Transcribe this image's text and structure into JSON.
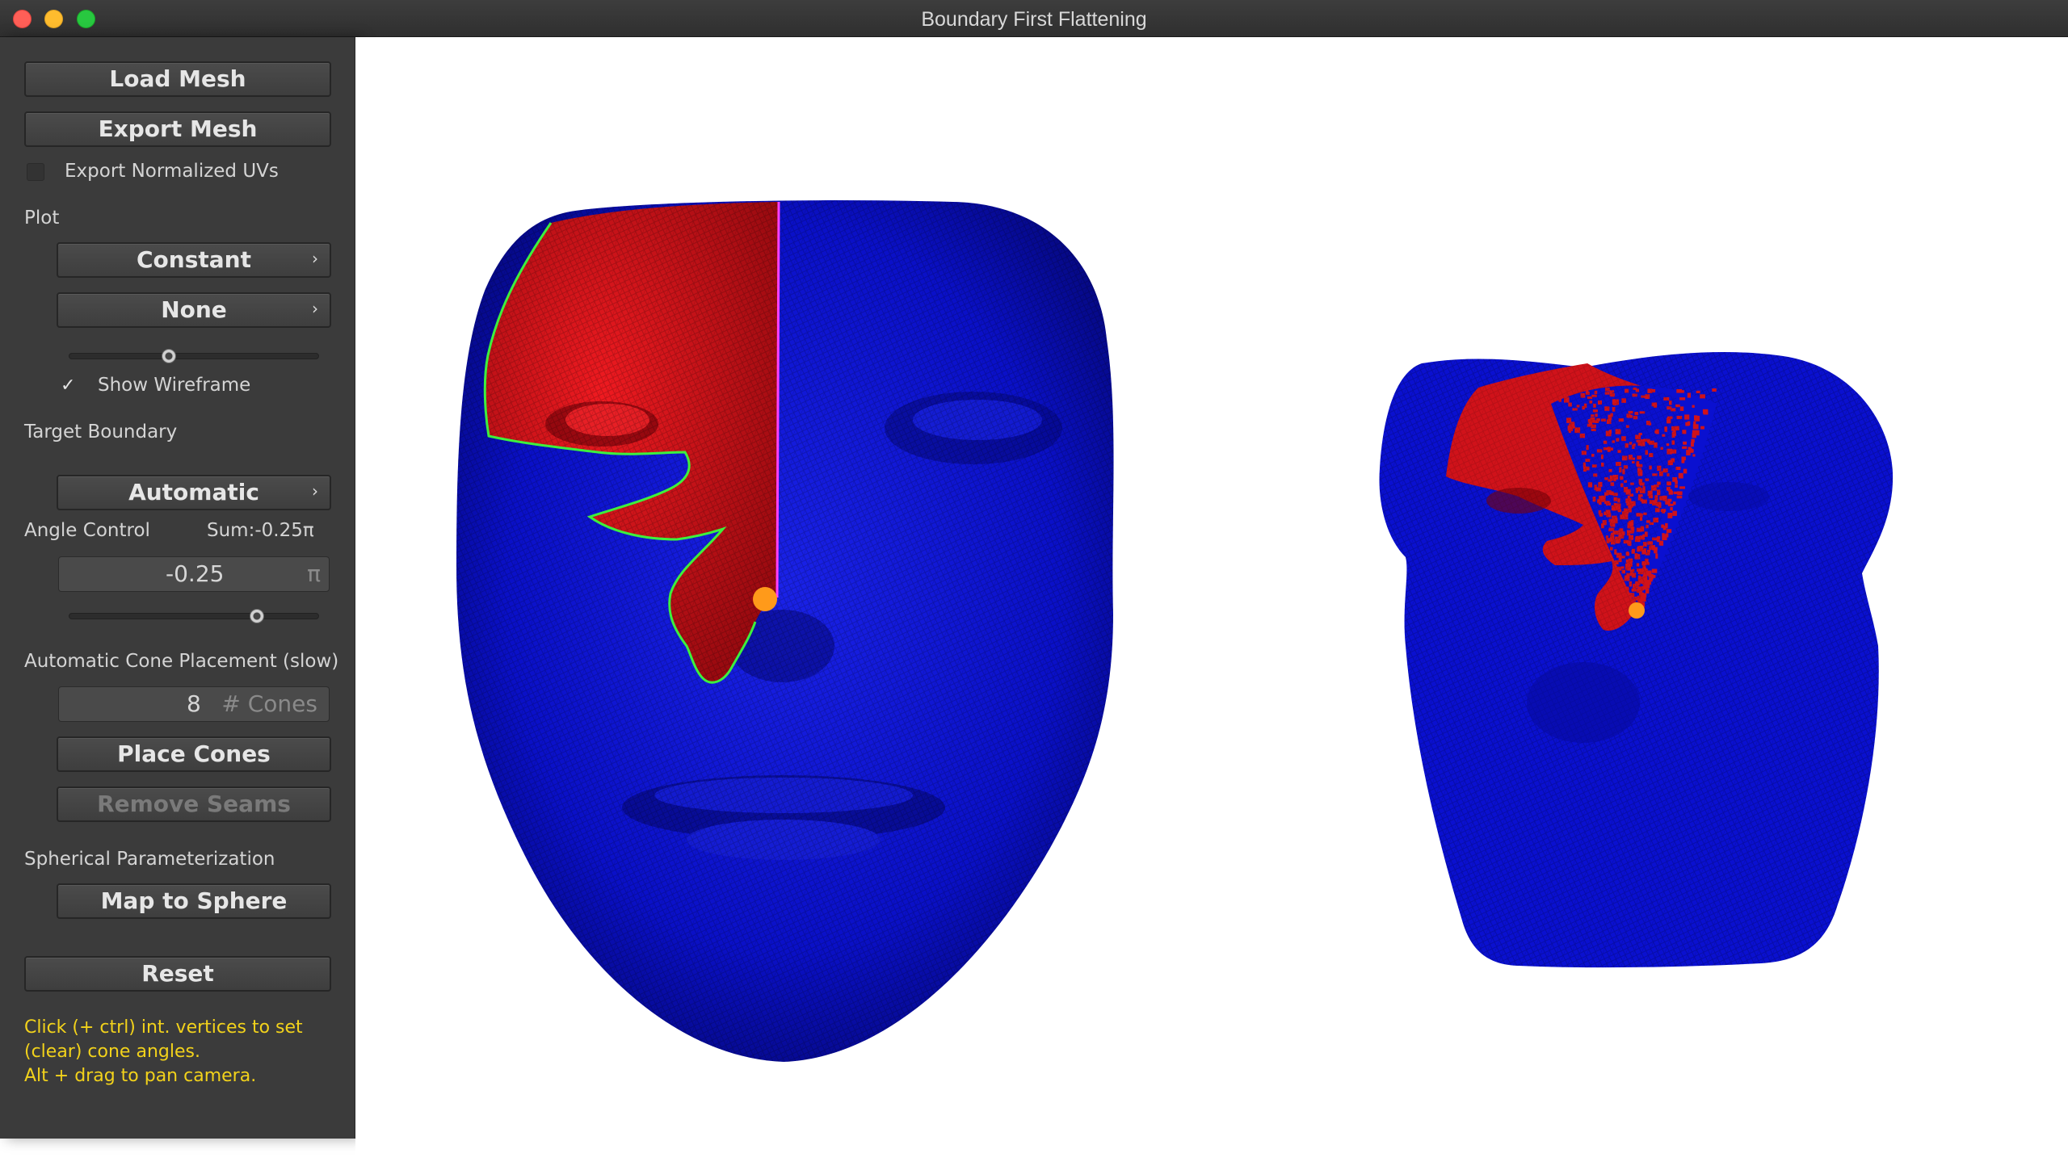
{
  "window": {
    "title": "Boundary First Flattening"
  },
  "panel": {
    "load_mesh": "Load Mesh",
    "export_mesh": "Export Mesh",
    "export_normalized_uvs": {
      "label": "Export Normalized UVs",
      "checked": false
    },
    "plot": {
      "label": "Plot",
      "mode": "Constant",
      "overlay": "None",
      "slider_fraction": 0.4,
      "show_wireframe": {
        "label": "Show Wireframe",
        "checked": true
      }
    },
    "target_boundary": {
      "label": "Target Boundary",
      "value": "Automatic"
    },
    "angle_control": {
      "label": "Angle Control",
      "sum": "Sum:-0.25π",
      "value": "-0.25",
      "unit": "π",
      "slider_fraction": 0.75
    },
    "auto_cone": {
      "label": "Automatic Cone Placement (slow)",
      "count": "8",
      "count_unit": "# Cones",
      "place_cones": "Place Cones",
      "remove_seams": "Remove Seams"
    },
    "spherical": {
      "label": "Spherical Parameterization",
      "map_to_sphere": "Map to Sphere"
    },
    "reset": "Reset",
    "hints": [
      "Click (+ ctrl) int. vertices to set",
      "(clear) cone angles.",
      "Alt + drag to pan camera."
    ]
  },
  "colors": {
    "mesh_blue": "#0a10c8",
    "mesh_red": "#d0121a",
    "seam_green": "#3df03d",
    "seam_magenta": "#ff40ff",
    "cone_orange": "#ff9a1a",
    "hint_yellow": "#f2d21b"
  }
}
